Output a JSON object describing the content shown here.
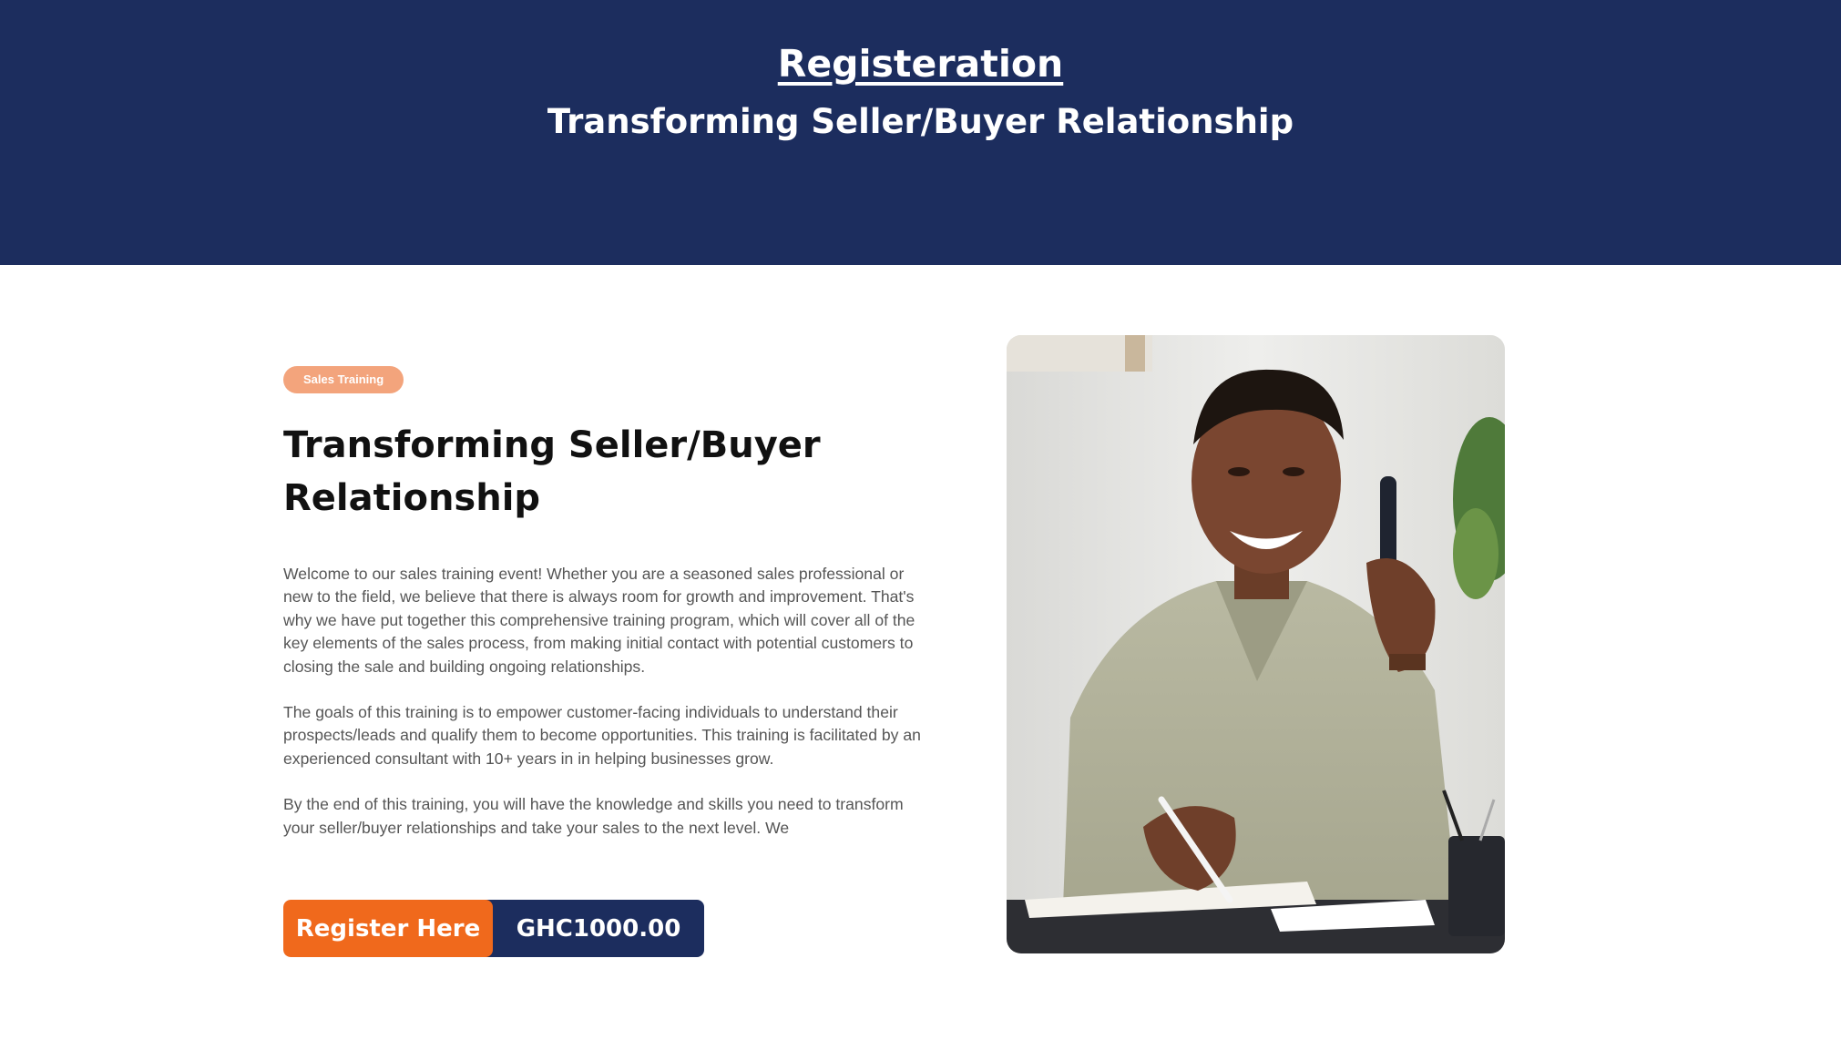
{
  "hero": {
    "title": "Registeration",
    "subtitle": "Transforming Seller/Buyer Relationship"
  },
  "event": {
    "badge": "Sales Training",
    "heading": "Transforming Seller/Buyer Relationship",
    "paragraphs": [
      "Welcome to our sales training event! Whether you are a seasoned sales professional or new to the field, we believe that there is always room for growth and improvement. That's why we have put together this comprehensive training program, which will cover all of the key elements of the sales process, from making initial contact with potential customers to closing the sale and building ongoing relationships.",
      "The goals of this training is to empower customer-facing individuals to understand their prospects/leads and qualify them to become opportunities. This training is facilitated by an experienced consultant with 10+ years in in helping businesses grow.",
      "By the end of this training, you will have the knowledge and skills you need to transform your seller/buyer relationships and take your sales to the next level. We"
    ],
    "register_label": "Register Here",
    "price": "GHC1000.00"
  },
  "colors": {
    "navy": "#1c2d5e",
    "orange": "#f0691c",
    "badge": "#f3a47c"
  },
  "photo": {
    "icon": "man-on-phone-photo"
  }
}
